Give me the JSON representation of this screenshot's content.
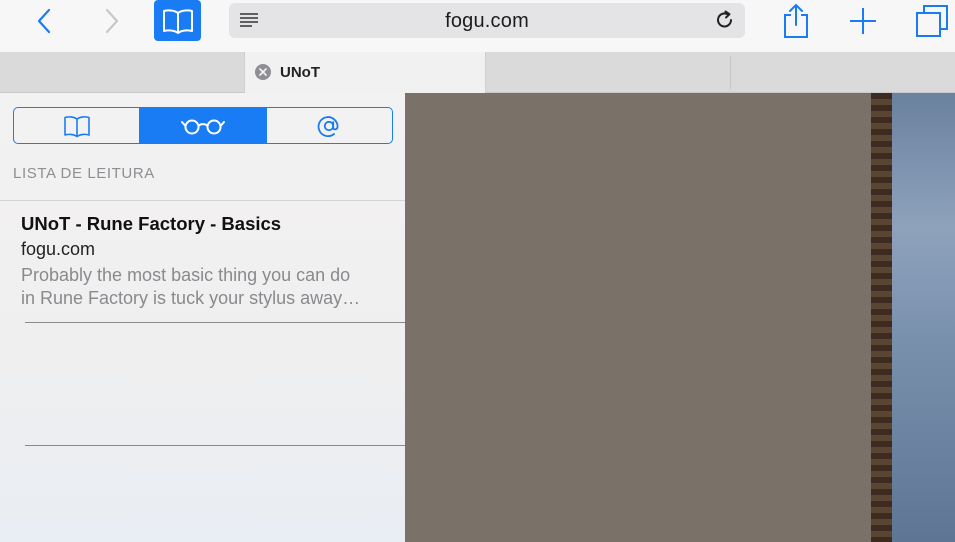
{
  "toolbar": {
    "url": "fogu.com"
  },
  "tab": {
    "title": "UNoT"
  },
  "sidebar": {
    "section_title": "LISTA DE LEITURA",
    "segments": [
      "bookmarks",
      "reading-list",
      "shared-links"
    ],
    "active_segment": "reading-list",
    "items": [
      {
        "title": "UNoT - Rune Factory - Basics",
        "url": "fogu.com",
        "excerpt_line1": "Probably the most basic thing you can do",
        "excerpt_line2": "in Rune Factory is tuck your stylus away…"
      }
    ]
  },
  "colors": {
    "accent": "#1a7cf5",
    "page_background": "#7a7268"
  }
}
